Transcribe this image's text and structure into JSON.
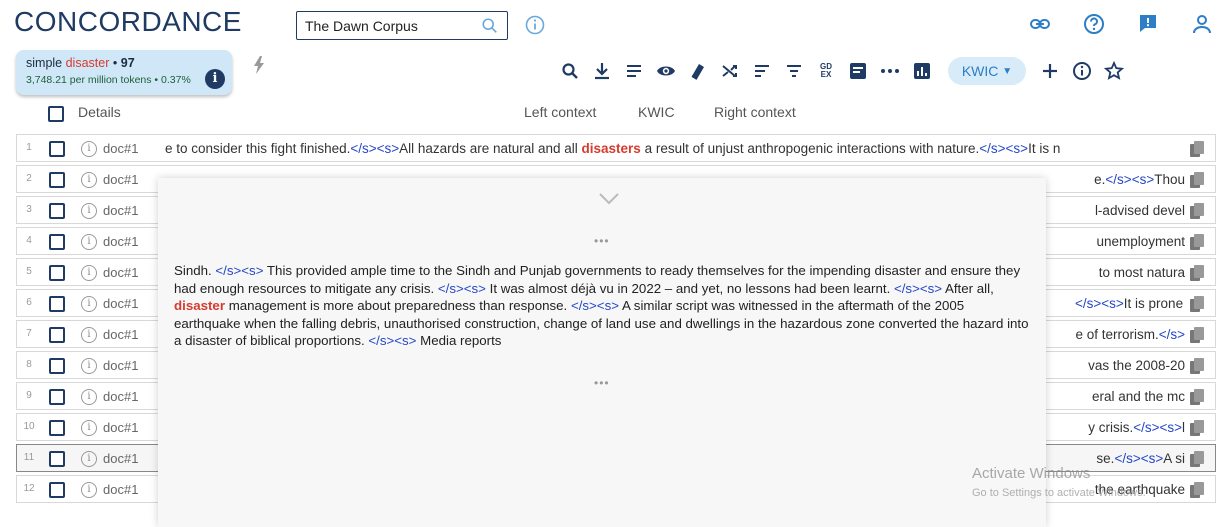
{
  "app": {
    "title": "CONCORDANCE"
  },
  "corpus": {
    "value": "The Dawn Corpus",
    "placeholder": ""
  },
  "query": {
    "prefix": "simple",
    "term": "disaster",
    "hits": "97",
    "bullet": "•",
    "stats": "3,748.21 per million tokens • 0.37%"
  },
  "toolbar": {
    "view_mode": "KWIC",
    "icons": [
      "search-icon",
      "download-icon",
      "list-icon",
      "eye-icon",
      "dictionary-icon",
      "shuffle-icon",
      "sort-icon",
      "filter-icon",
      "gdex-icon",
      "text-type-icon",
      "dots-icon",
      "frequency-chart-icon",
      "plus-icon",
      "info-icon",
      "star-icon"
    ],
    "gdex": "GD EX"
  },
  "columns": {
    "details": "Details",
    "left": "Left context",
    "kwic": "KWIC",
    "right": "Right context"
  },
  "colors": {
    "brand": "#1f3b63",
    "keyword": "#d63b2f",
    "tag": "#2446c7",
    "chip": "#cfe7f6"
  },
  "rows": [
    {
      "num": "1",
      "doc": "doc#1",
      "left": "e to consider this fight finished.",
      "tag1": "</s><s>",
      "pre": "All hazards are natural and all ",
      "kw": "disasters",
      "post": " a result of unjust anthropogenic interactions with nature.",
      "tag2": "</s><s>",
      "tail": "It is n"
    },
    {
      "num": "2",
      "doc": "doc#1",
      "right": "e.",
      "right_tag": "</s><s>",
      "right_tail": "Thou"
    },
    {
      "num": "3",
      "doc": "doc#1",
      "right": "l-advised devel",
      "right_tag": "",
      "right_tail": ""
    },
    {
      "num": "4",
      "doc": "doc#1",
      "right": "unemployment",
      "right_tag": "",
      "right_tail": ""
    },
    {
      "num": "5",
      "doc": "doc#1",
      "right": "to most natura",
      "right_tag": "",
      "right_tail": ""
    },
    {
      "num": "6",
      "doc": "doc#1",
      "right": "",
      "right_tag": "</s><s>",
      "right_tail": "It is prone to fl"
    },
    {
      "num": "7",
      "doc": "doc#1",
      "right": "e of terrorism.",
      "right_tag": "</s>",
      "right_tail": ""
    },
    {
      "num": "8",
      "doc": "doc#1",
      "right": "vas the 2008-20",
      "right_tag": "",
      "right_tail": ""
    },
    {
      "num": "9",
      "doc": "doc#1",
      "right": "eral and the mc",
      "right_tag": "",
      "right_tail": ""
    },
    {
      "num": "10",
      "doc": "doc#1",
      "right": "y crisis.",
      "right_tag": "</s><s>",
      "right_tail": "l"
    },
    {
      "num": "11",
      "doc": "doc#1",
      "right": "se.",
      "right_tag": "</s><s>",
      "right_tail": "A si"
    },
    {
      "num": "12",
      "doc": "doc#1",
      "right": "the earthquake",
      "right_tag": "",
      "right_tail": ""
    }
  ],
  "context": {
    "dots": "•••",
    "s1": "Sindh. ",
    "t1": "</s><s>",
    "s2": " This provided ample time to the Sindh and Punjab governments to ready themselves for the impending disaster and ensure they had enough resources to mitigate any crisis. ",
    "t2": "</s><s>",
    "s3": " It was almost déjà vu in 2022 – and yet, no lessons had been learnt. ",
    "t3": "</s><s>",
    "s4": " After all, ",
    "kw": "disaster",
    "s5": " management is more about preparedness than response. ",
    "t4": "</s><s>",
    "s6": " A similar script was witnessed in the aftermath of the 2005 earthquake when the falling debris, unauthorised construction, change of land use and dwellings in the hazardous zone converted the hazard into a disaster of biblical proportions. ",
    "t5": "</s><s>",
    "s7": " Media reports"
  },
  "watermark": {
    "line1": "Activate Windows",
    "line2": "Go to Settings to activate Windows."
  }
}
